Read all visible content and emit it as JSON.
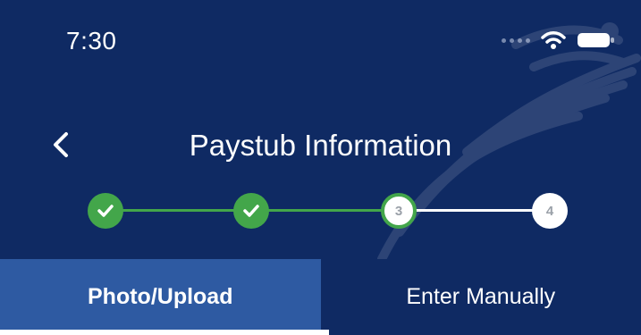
{
  "status_bar": {
    "time": "7:30",
    "icons": [
      "cellular-signal-icon",
      "wifi-icon",
      "battery-icon"
    ]
  },
  "header": {
    "back_icon": "chevron-left-icon",
    "title": "Paystub Information"
  },
  "stepper": {
    "steps": [
      {
        "label": "",
        "state": "completed",
        "icon": "check-icon"
      },
      {
        "label": "",
        "state": "completed",
        "icon": "check-icon"
      },
      {
        "label": "3",
        "state": "current"
      },
      {
        "label": "4",
        "state": "upcoming"
      }
    ]
  },
  "tabs": [
    {
      "label": "Photo/Upload",
      "active": true
    },
    {
      "label": "Enter Manually",
      "active": false
    }
  ],
  "colors": {
    "background": "#0f2a63",
    "active_tab": "#2e5aa2",
    "success": "#43a64a",
    "white": "#ffffff"
  }
}
